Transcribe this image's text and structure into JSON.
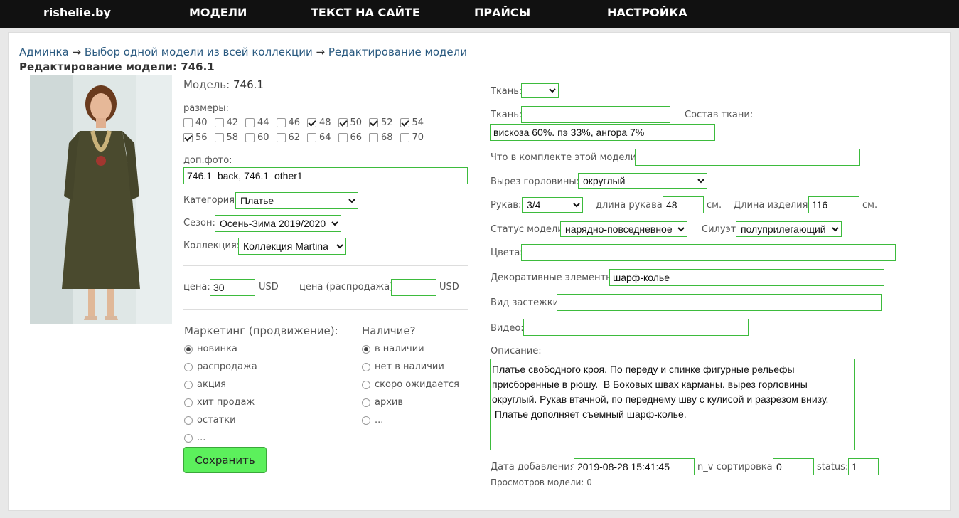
{
  "nav": {
    "brand": "rishelie.by",
    "models": "МОДЕЛИ",
    "site_text": "ТЕКСТ НА САЙТЕ",
    "prices": "ПРАЙСЫ",
    "settings": "НАСТРОЙКА"
  },
  "breadcrumb": {
    "admin": "Админка",
    "arrow": "→",
    "select_model": "Выбор одной модели из всей коллекции",
    "edit_model": "Редактирование модели"
  },
  "page_title": "Редактирование модели: 746.1",
  "model": {
    "label": "Модель:",
    "value": "746.1"
  },
  "sizes": {
    "label": "размеры:",
    "items": [
      {
        "size": "40",
        "checked": false
      },
      {
        "size": "42",
        "checked": false
      },
      {
        "size": "44",
        "checked": false
      },
      {
        "size": "46",
        "checked": false
      },
      {
        "size": "48",
        "checked": true
      },
      {
        "size": "50",
        "checked": true
      },
      {
        "size": "52",
        "checked": true
      },
      {
        "size": "54",
        "checked": true
      },
      {
        "size": "56",
        "checked": true
      },
      {
        "size": "58",
        "checked": false
      },
      {
        "size": "60",
        "checked": false
      },
      {
        "size": "62",
        "checked": false
      },
      {
        "size": "64",
        "checked": false
      },
      {
        "size": "66",
        "checked": false
      },
      {
        "size": "68",
        "checked": false
      },
      {
        "size": "70",
        "checked": false
      }
    ]
  },
  "extra_photo": {
    "label": "доп.фото:",
    "value": "746.1_back, 746.1_other1"
  },
  "category": {
    "label": "Категория:",
    "value": "Платье"
  },
  "season": {
    "label": "Сезон:",
    "value": "Осень-Зима 2019/2020"
  },
  "collection": {
    "label": "Коллекция:",
    "value": "Коллекция Martina"
  },
  "price": {
    "label": "цена:",
    "value": "30",
    "currency": "USD"
  },
  "sale_price": {
    "label": "цена (распродажа):",
    "value": "",
    "currency": "USD"
  },
  "marketing": {
    "title": "Маркетинг (продвижение):",
    "options": [
      "новинка",
      "распродажа",
      "акция",
      "хит продаж",
      "остатки",
      "..."
    ],
    "selected": 0
  },
  "availability": {
    "title": "Наличие?",
    "options": [
      "в наличии",
      "нет в наличии",
      "скоро ожидается",
      "архив",
      "..."
    ],
    "selected": 0
  },
  "save_label": "Сохранить",
  "right": {
    "fabric_select": {
      "label": "Ткань:",
      "value": ""
    },
    "fabric_text": {
      "label": "Ткань:",
      "value": ""
    },
    "composition": {
      "label": "Состав ткани:",
      "value": "вискоза 60%. пэ 33%, ангора 7%"
    },
    "kit": {
      "label": "Что в комплекте этой модели?:",
      "value": ""
    },
    "neckline": {
      "label": "Вырез горловины:",
      "value": "округлый"
    },
    "sleeve": {
      "label": "Рукав:",
      "value": "3/4"
    },
    "sleeve_length": {
      "label": "длина рукава:",
      "value": "48",
      "unit": "см."
    },
    "item_length": {
      "label": "Длина изделия:",
      "value": "116",
      "unit": "см."
    },
    "status": {
      "label": "Статус модели:",
      "value": "нарядно-повседневное"
    },
    "silhouette": {
      "label": "Силуэт:",
      "value": "полуприлегающий"
    },
    "colors": {
      "label": "Цвета:",
      "value": ""
    },
    "decor": {
      "label": "Декоративные элементы:",
      "value": "шарф-колье"
    },
    "fastener": {
      "label": "Вид застежки:",
      "value": ""
    },
    "video": {
      "label": "Видео:",
      "value": ""
    },
    "description": {
      "label": "Описание:",
      "value": "Платье свободного кроя. По переду и спинке фигурные рельефы присборенные в рюшу.  В Боковых швах карманы. вырез горловины округлый. Рукав втачной, по переднему шву с кулисой и разрезом внизу.\n Платье дополняет съемный шарф-колье."
    },
    "date_added": {
      "label": "Дата добавления:",
      "value": "2019-08-28 15:41:45"
    },
    "sort": {
      "label": "n_v сортировка:",
      "value": "0"
    },
    "status_num": {
      "label": "status:",
      "value": "1"
    },
    "views": "Просмотров модели: 0"
  },
  "colors": {
    "accent_border": "#3dbb3d",
    "save_button": "#5cf05c",
    "topbar": "#111111",
    "link": "#2a5a80"
  }
}
